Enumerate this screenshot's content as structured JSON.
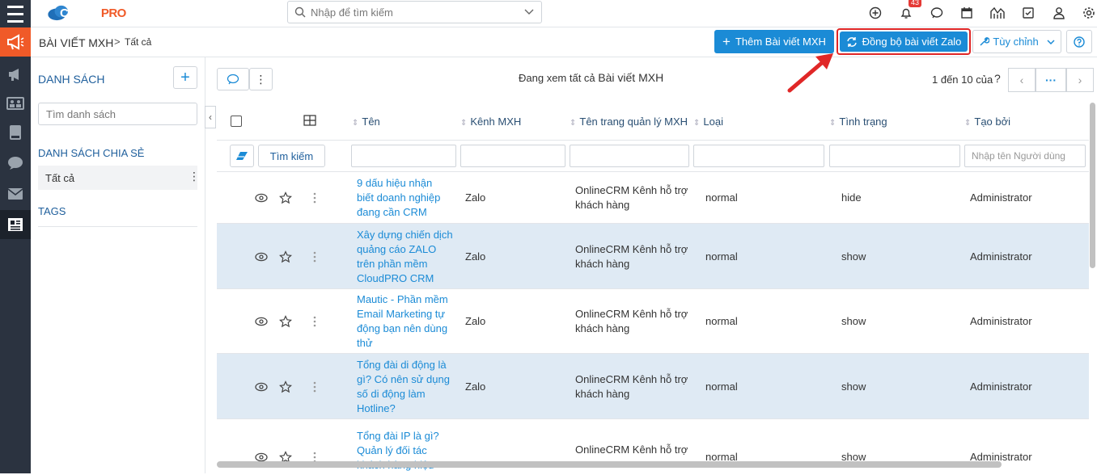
{
  "app": {
    "logo_text_1": "CLOUD",
    "logo_text_2": "PRO"
  },
  "search": {
    "placeholder": "Nhập để tìm kiếm"
  },
  "notifications": {
    "count": "43"
  },
  "breadcrumb": {
    "module": "BÀI VIẾT MXH",
    "separator": ">",
    "view": "Tất cả"
  },
  "toolbar": {
    "add_label": "Thêm Bài viết MXH",
    "sync_label": "Đồng bộ bài viết Zalo",
    "customize_label": "Tùy chỉnh"
  },
  "sidebar": {
    "title": "DANH SÁCH",
    "add_symbol": "+",
    "search_placeholder": "Tìm danh sách",
    "shared_title": "DANH SÁCH CHIA SẺ",
    "shared_items": [
      {
        "label": "Tất cả"
      }
    ],
    "tags_title": "TAGS"
  },
  "list": {
    "viewing_prefix": "Đang xem tất cả",
    "viewing_module": "Bài viết MXH",
    "paging": "1 đến 10 của",
    "paging_help": "?",
    "search_button": "Tìm kiếm",
    "creator_filter_placeholder": "Nhập tên Người dùng",
    "columns": [
      "Tên",
      "Kênh MXH",
      "Tên trang quản lý MXH",
      "Loại",
      "Tình trạng",
      "Tạo bởi"
    ],
    "rows": [
      {
        "name": [
          "9 dấu hiệu nhận",
          "biết doanh nghiệp",
          "đang cần CRM"
        ],
        "channel": "Zalo",
        "page": [
          "OnlineCRM Kênh hỗ trợ",
          "khách hàng"
        ],
        "type": "normal",
        "status": "hide",
        "creator": "Administrator"
      },
      {
        "name": [
          "Xây dựng chiến dịch",
          "quảng cáo ZALO",
          "trên phần mềm",
          "CloudPRO CRM"
        ],
        "channel": "Zalo",
        "page": [
          "OnlineCRM Kênh hỗ trợ",
          "khách hàng"
        ],
        "type": "normal",
        "status": "show",
        "creator": "Administrator"
      },
      {
        "name": [
          "Mautic - Phần mềm",
          "Email Marketing tự",
          "động bạn nên dùng",
          "thử"
        ],
        "channel": "Zalo",
        "page": [
          "OnlineCRM Kênh hỗ trợ",
          "khách hàng"
        ],
        "type": "normal",
        "status": "show",
        "creator": "Administrator"
      },
      {
        "name": [
          "Tổng đài di động là",
          "gì? Có nên sử dụng",
          "số di động làm",
          "Hotline?"
        ],
        "channel": "Zalo",
        "page": [
          "OnlineCRM Kênh hỗ trợ",
          "khách hàng"
        ],
        "type": "normal",
        "status": "show",
        "creator": "Administrator"
      },
      {
        "name": [
          "Tổng đài IP là gì?",
          "Quản lý đối tác",
          "khách hàng hiệu"
        ],
        "channel": "",
        "page": [
          "OnlineCRM Kênh hỗ trợ",
          ""
        ],
        "type": "normal",
        "status": "show",
        "creator": "Administrator"
      }
    ]
  },
  "colors": {
    "primary": "#1b8bd6",
    "rail": "#2b3340",
    "rail_active": "#f05a28",
    "highlight": "#e02727",
    "row_alt": "#dfeaf4"
  }
}
